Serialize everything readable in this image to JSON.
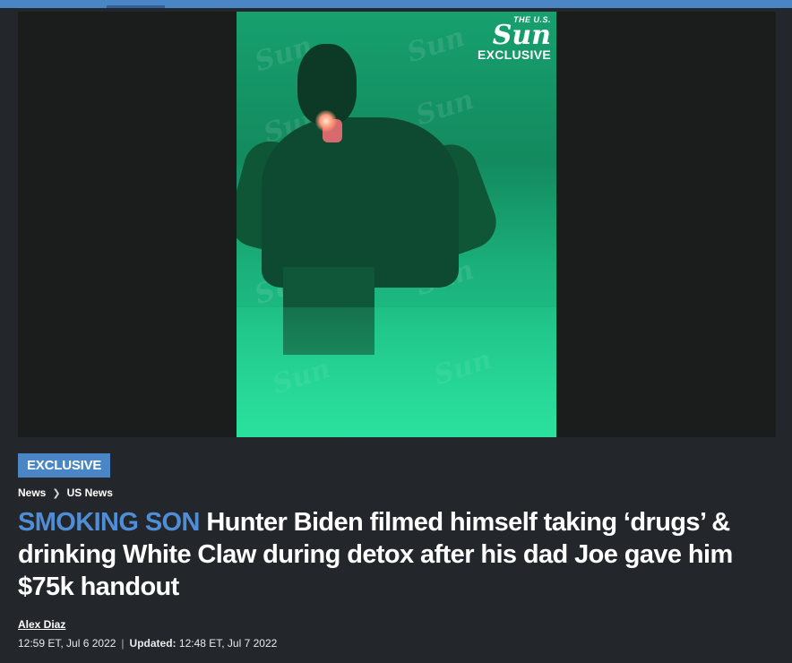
{
  "media": {
    "logo_sub": "THE U.S.",
    "logo_main": "Sun",
    "logo_label": "EXCLUSIVE",
    "watermark": "Sun"
  },
  "article": {
    "badge": "EXCLUSIVE",
    "breadcrumb": [
      "News",
      "US News"
    ],
    "kicker": "SMOKING SON",
    "headline": " Hunter Biden filmed himself taking ‘drugs’ & drinking White Claw during detox after his dad Joe gave him $75k handout",
    "author": "Alex Diaz",
    "published": "12:59 ET, Jul 6 2022",
    "updated_label": "Updated:",
    "updated": "12:48 ET, Jul 7 2022"
  },
  "colors": {
    "accent": "#4a86c5",
    "kicker": "#4f8ed6",
    "background": "#23272b"
  }
}
